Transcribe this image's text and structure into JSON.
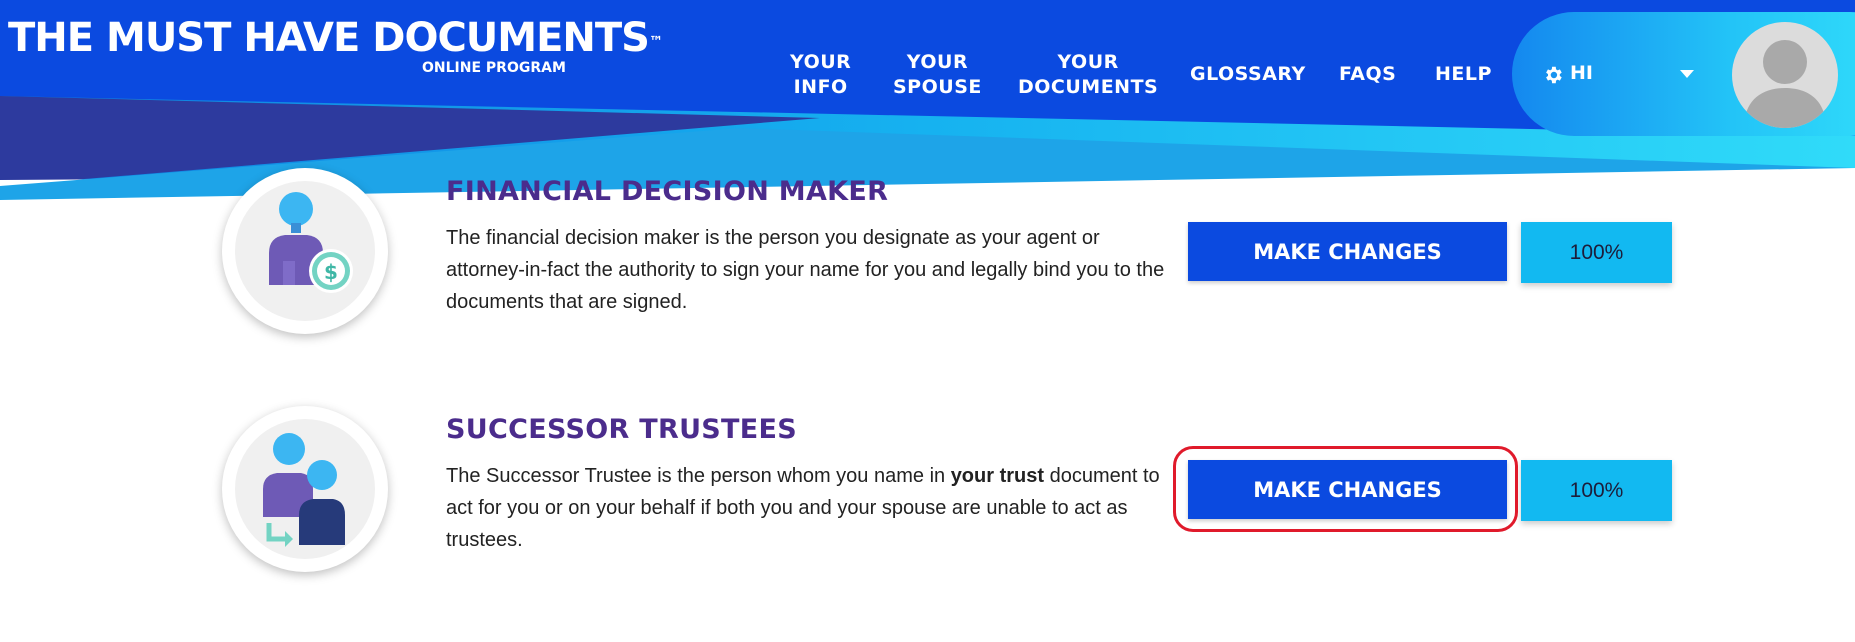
{
  "header": {
    "logo_title": "THE MUST HAVE DOCUMENTS",
    "logo_tm": "™",
    "logo_subtitle": "ONLINE PROGRAM",
    "nav": [
      {
        "line1": "YOUR",
        "line2": "INFO"
      },
      {
        "line1": "YOUR",
        "line2": "SPOUSE"
      },
      {
        "line1": "YOUR",
        "line2": "DOCUMENTS"
      },
      {
        "line1": "GLOSSARY"
      },
      {
        "line1": "FAQS"
      },
      {
        "line1": "HELP"
      }
    ],
    "user_greeting": "HI",
    "icons": {
      "settings": "gear-icon",
      "menu": "caret-down-icon",
      "avatar": "user-avatar-icon"
    }
  },
  "sections": [
    {
      "title": "FINANCIAL DECISION MAKER",
      "description": "The financial decision maker is the person you designate as your agent or attorney-in-fact the authority to sign your name for you and legally bind you to the documents that are signed.",
      "button_label": "MAKE CHANGES",
      "progress_text": "100%",
      "progress": 1.0,
      "icon": "person-dollar-icon"
    },
    {
      "title": "SUCCESSOR TRUSTEES",
      "description_before": "The Successor Trustee is the person whom you name in ",
      "description_bold": "your trust",
      "description_after": " document to act for you or on your behalf if both you and your spouse are unable to act as trustees.",
      "button_label": "MAKE CHANGES",
      "progress_text": "100%",
      "progress": 1.0,
      "icon": "two-persons-arrow-icon",
      "highlighted": true
    }
  ],
  "colors": {
    "primary": "#0b4ae0",
    "accent": "#12b9f1",
    "title": "#4b2c8c",
    "highlight": "#e01a2b"
  }
}
